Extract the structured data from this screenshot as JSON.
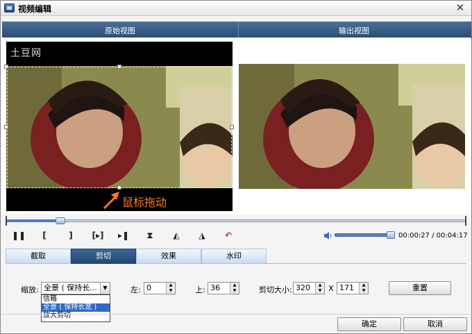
{
  "window": {
    "title": "视频编辑",
    "close_glyph": "✕"
  },
  "views": {
    "original": "原始视图",
    "output": "输出视图"
  },
  "preview": {
    "watermark": "土豆网",
    "drag_hint": "鼠标拖动"
  },
  "player": {
    "progress": 0.107,
    "current_time": "00:00:27",
    "total_time": "00:04:17",
    "time_display": "00:00:27 / 00:04:17",
    "volume": 0.9,
    "buttons": {
      "pause": "❚❚",
      "mark_in": "[",
      "mark_out": "]",
      "next_frame": "[▸]",
      "step_end": "▸❚",
      "flip_vertical": "⧗",
      "rotate_left": "◭",
      "rotate_right": "◮",
      "undo": "↶"
    }
  },
  "tabs": [
    "截取",
    "剪切",
    "效果",
    "水印"
  ],
  "active_tab": 1,
  "crop": {
    "zoom_label": "缩放:",
    "zoom_value": "全景 ( 保持长...",
    "zoom_options": [
      "信箱",
      "全景 ( 保持长宽 )",
      "放大剪切"
    ],
    "zoom_selected_index": 1,
    "left_label": "左:",
    "left_value": "0",
    "top_label": "上:",
    "top_value": "36",
    "size_label": "剪切大小:",
    "width_value": "320",
    "times": "X",
    "height_value": "171",
    "reset_label": "重置"
  },
  "footer": {
    "ok_label": "确定",
    "cancel_label": "取消"
  },
  "colors": {
    "header": "#294c74",
    "accent_orange": "#ff7a1a",
    "tab_active": "#214871"
  }
}
